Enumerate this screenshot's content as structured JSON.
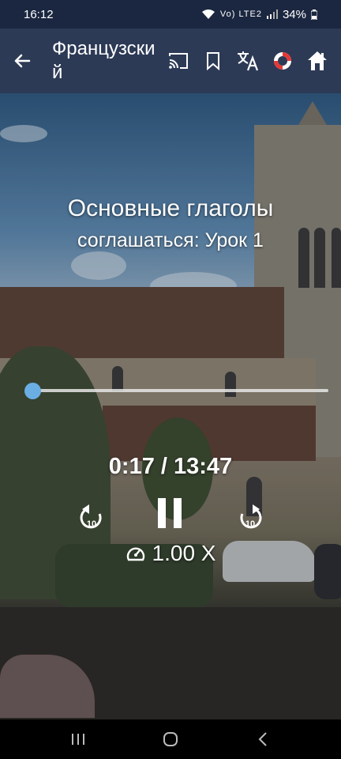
{
  "status_bar": {
    "time": "16:12",
    "network_label": "Vo) LTE2",
    "battery": "34%"
  },
  "app_bar": {
    "title": "Французский",
    "actions": [
      "cast-icon",
      "bookmark-icon",
      "translate-icon",
      "lifebuoy-icon",
      "home-icon"
    ]
  },
  "lesson": {
    "title": "Основные глаголы",
    "subtitle": "соглашаться: Урок 1"
  },
  "player": {
    "position": "0:17",
    "duration": "13:47",
    "time_display": "0:17 / 13:47",
    "progress_fraction": 0.02,
    "replay_seconds": "10",
    "forward_seconds": "10",
    "speed": "1.00 X"
  },
  "colors": {
    "status_bar": "#1b2740",
    "app_bar": "#2c3a56",
    "accent": "#6aaee4"
  }
}
